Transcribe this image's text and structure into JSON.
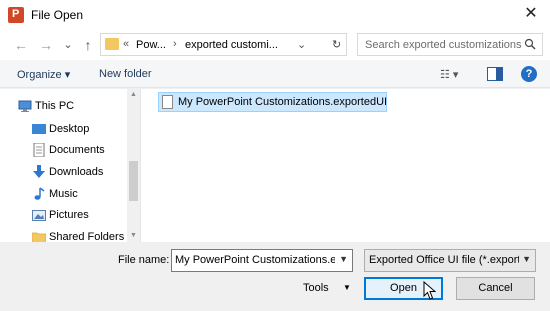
{
  "window": {
    "title": "File Open",
    "close_glyph": "✕"
  },
  "nav": {
    "back_glyph": "←",
    "forward_glyph": "→",
    "recent_glyph": "⌄",
    "up_glyph": "↑",
    "address": {
      "chevrons": "«",
      "crumb1": "Pow...",
      "sep": "›",
      "crumb2": "exported customi...",
      "dropdown_glyph": "⌄",
      "refresh_glyph": "↻"
    },
    "search_placeholder": "Search exported customizations"
  },
  "commandbar": {
    "organize": "Organize ▾",
    "new_folder": "New folder",
    "view_glyph": "☷ ▾",
    "help_glyph": "?"
  },
  "tree": {
    "items": [
      {
        "label": "This PC",
        "icon": "computer-icon"
      },
      {
        "label": "Desktop",
        "icon": "desktop-icon"
      },
      {
        "label": "Documents",
        "icon": "documents-icon"
      },
      {
        "label": "Downloads",
        "icon": "downloads-icon"
      },
      {
        "label": "Music",
        "icon": "music-icon"
      },
      {
        "label": "Pictures",
        "icon": "pictures-icon"
      },
      {
        "label": "Shared Folders",
        "icon": "folder-icon"
      }
    ]
  },
  "files": {
    "items": [
      {
        "label": "My PowerPoint Customizations.exportedUI",
        "icon": "file-icon"
      }
    ]
  },
  "bottom": {
    "file_name_label": "File name:",
    "file_name_value": "My PowerPoint Customizations.ex",
    "file_type": "Exported Office UI file (*.exporte",
    "tools_label": "Tools",
    "tools_arrow": "▼",
    "open_label": "Open",
    "cancel_label": "Cancel"
  },
  "colors": {
    "accent": "#0078d7",
    "selection": "#cce8ff",
    "folder": "#f3c860"
  }
}
